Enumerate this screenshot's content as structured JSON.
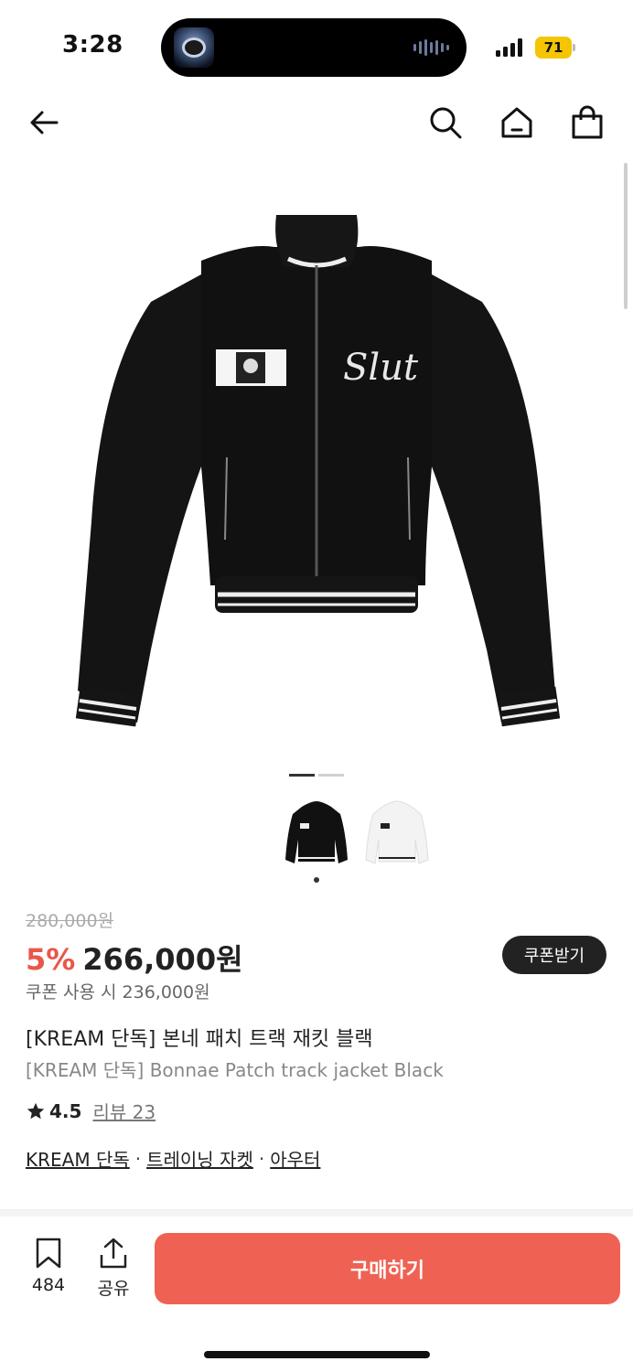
{
  "status_bar": {
    "time": "3:28",
    "battery": "71",
    "battery_color": "#f4c500"
  },
  "header": {
    "back_icon": "arrow-left-icon",
    "search_icon": "search-icon",
    "home_icon": "home-icon",
    "bag_icon": "shopping-bag-icon"
  },
  "product": {
    "image_index": 1,
    "image_count": 2,
    "jacket_logo": "Slut",
    "original_price": "280,000원",
    "discount": "5%",
    "price": "266,000원",
    "coupon_button": "쿠폰받기",
    "coupon_note": "쿠폰 사용 시 236,000원",
    "title_ko": "[KREAM 단독] 본네 패치 트랙 재킷 블랙",
    "title_en": "[KREAM 단독] Bonnae Patch track jacket Black",
    "rating": "4.5",
    "reviews": "리뷰 23",
    "tags": [
      "KREAM 단독",
      "트레이닝 자켓",
      "아우터"
    ],
    "tag_separator": "·"
  },
  "bottom_bar": {
    "bookmark_count": "484",
    "share_label": "공유",
    "buy_label": "구매하기",
    "buy_color": "#ef6253"
  }
}
